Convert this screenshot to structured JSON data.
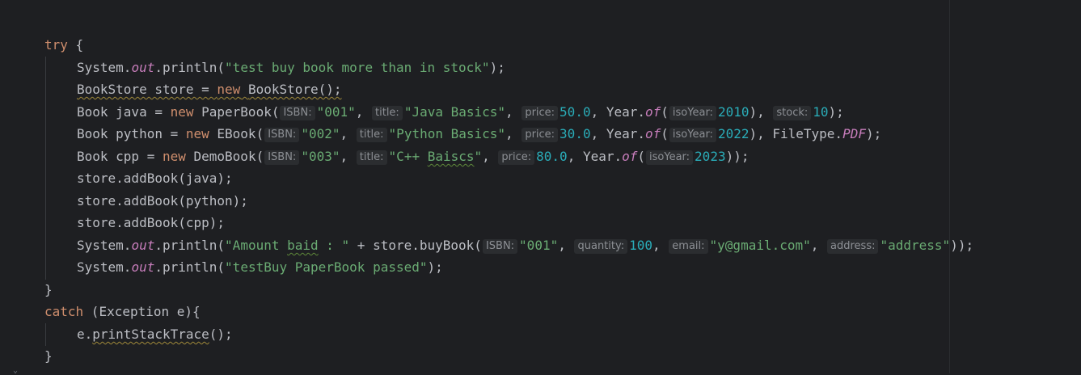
{
  "code": {
    "try_kw": "try",
    "open_brace": " {",
    "close_brace": "}",
    "catch_kw": "catch",
    "catch_rest": " (Exception e){",
    "line1": {
      "a": "System.",
      "out": "out",
      "b": ".println(",
      "str": "\"test buy book more than in stock\"",
      "c": ");"
    },
    "line2": {
      "decl": "BookStore store = ",
      "new": "new",
      "ctor": "BookStore();"
    },
    "line3": {
      "a": "Book java = ",
      "new": "new",
      "b": " PaperBook(",
      "hint_isbn": "ISBN:",
      "isbn": "\"001\"",
      "comma": ", ",
      "hint_title": "title:",
      "title": "\"Java Basics\"",
      "hint_price": "price:",
      "price": "50.0",
      "year_a": ", Year.",
      "of": "of",
      "paren": "(",
      "hint_isoyear": "isoYear:",
      "year": "2010",
      "close": "), ",
      "hint_stock": "stock:",
      "stock": "10",
      "end": ");"
    },
    "line4": {
      "a": "Book python = ",
      "new": "new",
      "b": " EBook(",
      "hint_isbn": "ISBN:",
      "isbn": "\"002\"",
      "comma": ", ",
      "hint_title": "title:",
      "title": "\"Python Basics\"",
      "hint_price": "price:",
      "price": "30.0",
      "year_a": ", Year.",
      "of": "of",
      "paren": "(",
      "hint_isoyear": "isoYear:",
      "year": "2022",
      "close": "), FileType.",
      "pdf": "PDF",
      "end": ");"
    },
    "line5": {
      "a": "Book cpp = ",
      "new": "new",
      "b": " DemoBook(",
      "hint_isbn": "ISBN:",
      "isbn": "\"003\"",
      "comma": ", ",
      "hint_title": "title:",
      "title_a": "\"C++ ",
      "title_b": "Baiscs",
      "title_c": "\"",
      "hint_price": "price:",
      "price": "80.0",
      "year_a": ", Year.",
      "of": "of",
      "paren": "(",
      "hint_isoyear": "isoYear:",
      "year": "2023",
      "end": "));"
    },
    "line6": "store.addBook(java);",
    "line7": "store.addBook(python);",
    "line8": "store.addBook(cpp);",
    "line9": {
      "a": "System.",
      "out": "out",
      "b": ".println(",
      "str_a": "\"Amount ",
      "str_b": "baid",
      "str_c": " : \"",
      "c": " + store.buyBook(",
      "hint_isbn": "ISBN:",
      "isbn": "\"001\"",
      "comma": ", ",
      "hint_qty": "quantity:",
      "qty": "100",
      "hint_email": "email:",
      "email": "\"y@gmail.com\"",
      "hint_address": "address:",
      "address": "\"address\"",
      "end": "));"
    },
    "line10": {
      "a": "System.",
      "out": "out",
      "b": ".println(",
      "str": "\"testBuy PaperBook passed\"",
      "c": ");"
    },
    "catch_body": {
      "a": "e.",
      "method": "printStackTrace",
      "b": "();"
    }
  },
  "colors": {
    "background": "#1e1f22",
    "keyword": "#cf8e6d",
    "string": "#6aab73",
    "number": "#2aacb8",
    "static_field": "#c77dbb",
    "text": "#bcbec4",
    "hint_bg": "#2b2d30"
  }
}
